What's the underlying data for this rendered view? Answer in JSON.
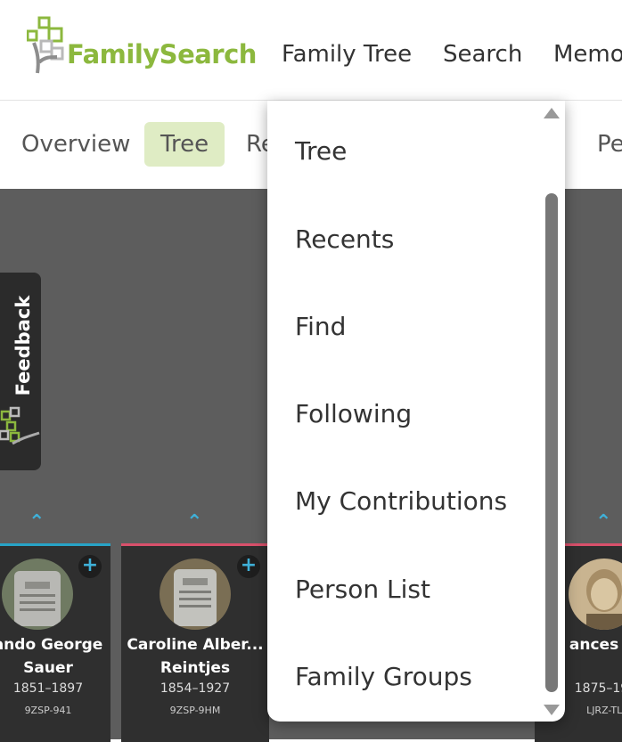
{
  "header": {
    "brand": "FamilySearch",
    "nav": [
      "Family Tree",
      "Search",
      "Memo"
    ]
  },
  "subnav": {
    "tabs": [
      "Overview",
      "Tree",
      "Re",
      "Pe"
    ],
    "active": "Tree"
  },
  "feedback": {
    "label": "Feedback"
  },
  "persons": [
    {
      "name_line1": "ando George",
      "name_line2": "Sauer",
      "dates": "1851–1897",
      "id": "9ZSP-941"
    },
    {
      "name_line1": "Caroline Alber...",
      "name_line2": "Reintjes",
      "dates": "1854–1927",
      "id": "9ZSP-9HM"
    },
    {
      "name_line1": "ances B",
      "dates": "1875–19",
      "id": "LJRZ-TLC"
    }
  ],
  "dropdown": {
    "items": [
      "Tree",
      "Recents",
      "Find",
      "Following",
      "My Contributions",
      "Person List",
      "Family Groups"
    ]
  },
  "colors": {
    "brand_green": "#8cb83e",
    "active_tab_bg": "#dfecc4",
    "male_border": "#27a3c6",
    "female_border": "#d9506b",
    "tree_bg": "#5d5d5d"
  }
}
